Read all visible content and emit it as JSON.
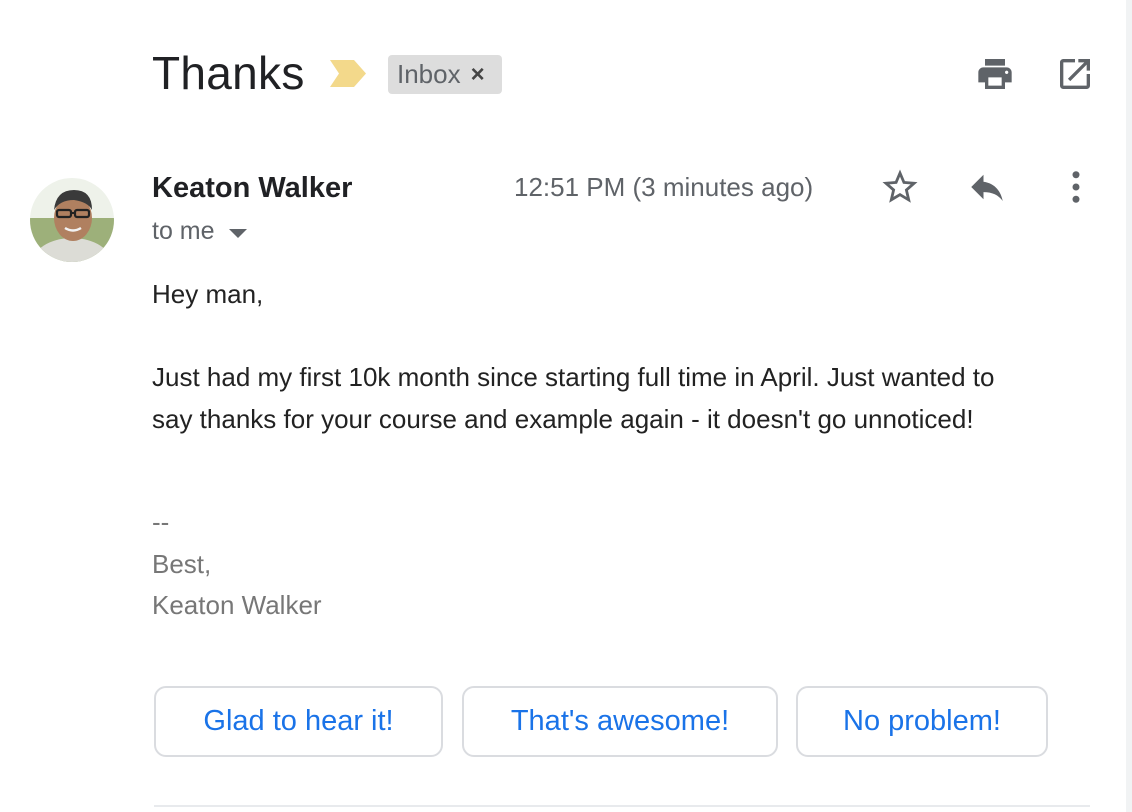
{
  "message": {
    "subject": "Thanks",
    "label": "Inbox",
    "label_close": "×",
    "sender": "Keaton Walker",
    "recipient": "to me",
    "timestamp": "12:51 PM (3 minutes ago)",
    "body": {
      "greeting": "Hey man,",
      "line1": "Just had my first 10k month since starting full time in April. Just wanted to",
      "line2": "say thanks for your course and example again - it doesn't go unnoticed!",
      "sig_separator": "--",
      "sig_closing": "Best,",
      "sig_name": "Keaton Walker"
    }
  },
  "smart_replies": [
    "Glad to hear it!",
    "That's awesome!",
    "No problem!"
  ],
  "icons": {
    "importance": "importance-marker-icon",
    "print": "print-icon",
    "open_new_window": "open-in-new-window-icon",
    "star": "star-icon",
    "reply": "reply-icon",
    "more": "more-vertical-icon"
  },
  "colors": {
    "importance_marker": "#f3d98b",
    "label_chip_bg": "#dddddd",
    "smart_reply_text": "#1a73e8",
    "signature_text": "#777777"
  }
}
